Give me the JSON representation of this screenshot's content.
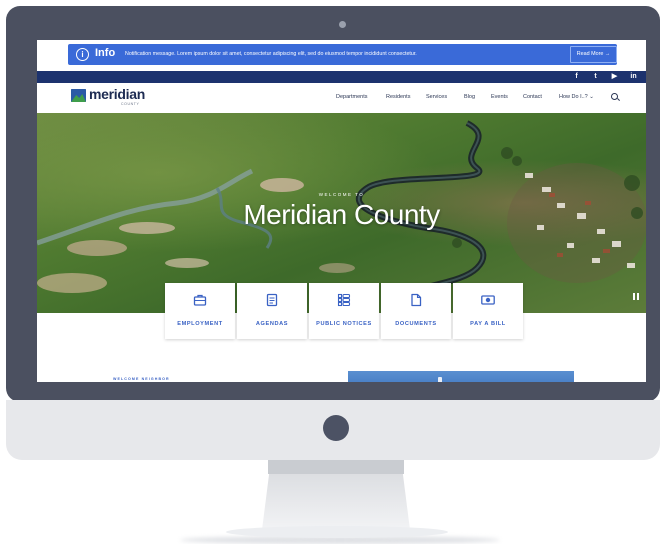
{
  "notification": {
    "title": "Info",
    "message": "Notification message. Lorem ipsum dolor sit amet, consectetur adipiscing elit, sed do eiusmod tempor incididunt consectetur.",
    "button": "Read More →"
  },
  "social": [
    "facebook-icon",
    "twitter-icon",
    "youtube-icon",
    "linkedin-icon"
  ],
  "logo": {
    "name": "meridian",
    "sub": "COUNTY"
  },
  "nav": [
    "Departments",
    "Residents",
    "Services",
    "Blog",
    "Events",
    "Contact",
    "How Do I..?"
  ],
  "hero": {
    "eyebrow": "WELCOME TO",
    "title": "Meridian County"
  },
  "quick_links": [
    {
      "label": "EMPLOYMENT",
      "icon": "briefcase-icon"
    },
    {
      "label": "AGENDAS",
      "icon": "document-list-icon"
    },
    {
      "label": "PUBLIC NOTICES",
      "icon": "list-icon"
    },
    {
      "label": "DOCUMENTS",
      "icon": "file-icon"
    },
    {
      "label": "PAY A BILL",
      "icon": "dollar-bill-icon"
    }
  ],
  "section": {
    "eyebrow": "WELCOME NEIGHBOR"
  },
  "colors": {
    "accent": "#3a62c4",
    "navy": "#1c326e",
    "notice": "#3a6ad8",
    "monitor": "#4b5060"
  }
}
